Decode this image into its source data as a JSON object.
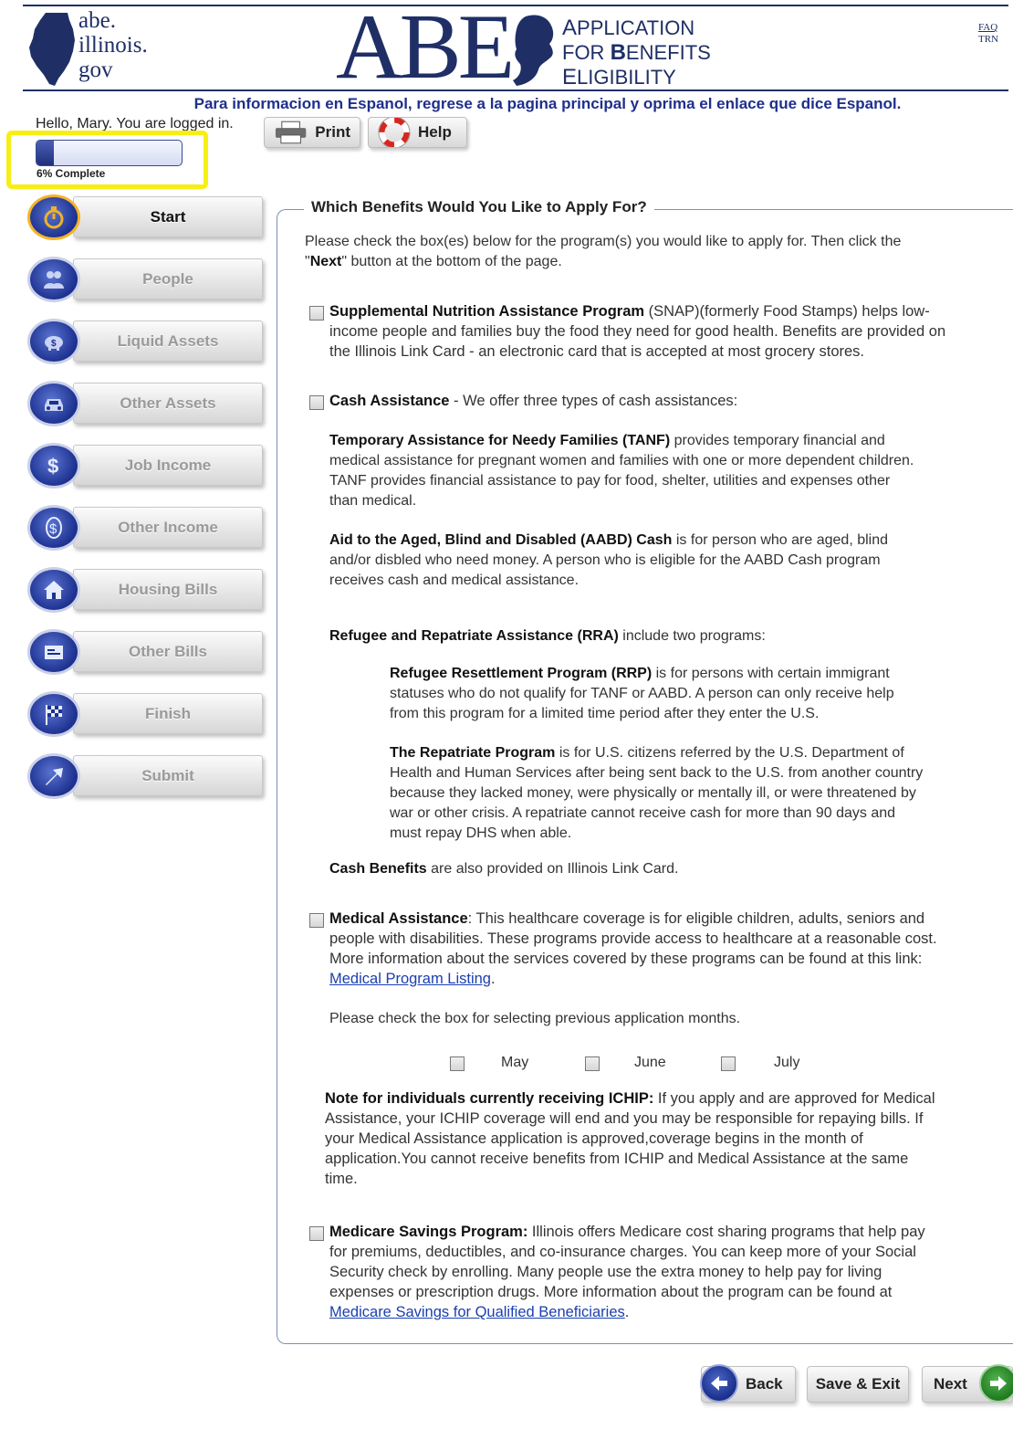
{
  "header": {
    "logo_lines": [
      "abe.",
      "illinois.",
      "gov"
    ],
    "abe_letters": "ABE",
    "app_title_lines": [
      {
        "cap": "A",
        "rest": "PPLICATION"
      },
      {
        "pre": "FOR ",
        "cap": "B",
        "rest": "ENEFITS"
      },
      {
        "cap": "E",
        "rest": "LIGIBILITY"
      }
    ],
    "faq_label": "FAQ",
    "trn_label": "TRN",
    "espanol_notice": "Para informacion en Espanol, regrese a la pagina principal y oprima el enlace que dice Espanol.",
    "greeting": "Hello, Mary. You are logged in."
  },
  "toolbar": {
    "print_label": "Print",
    "help_label": "Help"
  },
  "progress": {
    "percent": 6,
    "label": "6% Complete"
  },
  "sidebar": {
    "items": [
      {
        "label": "Start",
        "icon": "stopwatch-icon",
        "active": true
      },
      {
        "label": "People",
        "icon": "people-icon",
        "active": false
      },
      {
        "label": "Liquid Assets",
        "icon": "piggy-bank-icon",
        "active": false
      },
      {
        "label": "Other Assets",
        "icon": "car-icon",
        "active": false
      },
      {
        "label": "Job Income",
        "icon": "dollar-icon",
        "active": false
      },
      {
        "label": "Other Income",
        "icon": "coin-icon",
        "active": false
      },
      {
        "label": "Housing Bills",
        "icon": "house-icon",
        "active": false
      },
      {
        "label": "Other Bills",
        "icon": "bill-icon",
        "active": false
      },
      {
        "label": "Finish",
        "icon": "checkered-flag-icon",
        "active": false
      },
      {
        "label": "Submit",
        "icon": "arrow-icon",
        "active": false
      }
    ]
  },
  "main": {
    "title": "Which Benefits Would You Like to Apply For?",
    "intro_1": "Please check the box(es) below for the program(s) you would like to apply for. Then click the",
    "intro_2_pre": "\"",
    "intro_2_bold": "Next",
    "intro_2_post": "\" button at the bottom of the page.",
    "snap": {
      "bold": "Supplemental Nutrition Assistance Program",
      "line1": " (SNAP)(formerly Food Stamps) helps low-",
      "line2": "income people and families buy the food they need for good health. Benefits are provided on",
      "line3": "the Illinois Link Card - an electronic card that is accepted at most grocery stores."
    },
    "cash": {
      "bold": "Cash Assistance",
      "rest": " - We offer three types of cash assistances:",
      "tanf_bold": "Temporary Assistance for Needy Families (TANF)",
      "tanf_1": " provides temporary financial and",
      "tanf_2": "medical assistance for pregnant women and families with one or more dependent children.",
      "tanf_3": "TANF provides financial assistance to pay for food, shelter, utilities and expenses other",
      "tanf_4": "than medical.",
      "aabd_bold": "Aid to the Aged, Blind and Disabled (AABD) Cash",
      "aabd_1": " is for person who are aged, blind",
      "aabd_2": "and/or disbled who need money. A person who is eligible for the AABD Cash program",
      "aabd_3": "receives cash and medical assistance.",
      "rra_bold": "Refugee and Repatriate Assistance (RRA)",
      "rra_rest": " include two programs:",
      "rrp_bold": "Refugee Resettlement Program (RRP)",
      "rrp_1": " is for persons with certain immigrant",
      "rrp_2": "statuses who do not qualify for TANF or AABD. A person can only receive help",
      "rrp_3": "from this program for a limited time period after they enter the U.S.",
      "rep_bold": "The Repatriate Program",
      "rep_1": " is for U.S. citizens referred by the U.S. Department of",
      "rep_2": "Health and Human Services after being sent back to the U.S. from another country",
      "rep_3": "because they lacked money, were physically or mentally ill, or were threatened by",
      "rep_4": "war or other crisis. A repatriate cannot receive cash for more than 90 days and",
      "rep_5": "must repay DHS when able.",
      "benefits_bold": "Cash Benefits",
      "benefits_rest": " are also provided on Illinois Link Card."
    },
    "medical": {
      "bold": "Medical Assistance",
      "line1": ": This healthcare coverage is for eligible children, adults, seniors and",
      "line2": "people with disabilities. These programs provide access to healthcare at a reasonable cost.",
      "line3": "More information about the services covered by these programs can be found at this link:",
      "link": "Medical Program Listing",
      "link_after": ".",
      "months_prompt": "Please check the box for selecting previous application months.",
      "months": [
        "May",
        "June",
        "July"
      ],
      "ichip_bold": "Note for individuals currently receiving ICHIP:",
      "ichip_1": " If you apply and are approved for Medical",
      "ichip_2": "Assistance, your ICHIP coverage will end and you may be responsible for repaying bills. If",
      "ichip_3": "your Medical Assistance application is approved,coverage begins in the month of",
      "ichip_4": "application.You cannot receive benefits from ICHIP and Medical Assistance at the same",
      "ichip_5": "time."
    },
    "medicare": {
      "bold": "Medicare Savings Program:",
      "line1": " Illinois offers Medicare cost sharing programs that help pay",
      "line2": "for premiums, deductibles, and co-insurance charges. You can keep more of your Social",
      "line3": "Security check by enrolling. Many people use the extra money to help pay for living",
      "line4": "expenses or prescription drugs. More information about the program can be found at",
      "link": "Medicare Savings for Qualified Beneficiaries",
      "link_after": "."
    }
  },
  "footer": {
    "back_label": "Back",
    "save_label": "Save & Exit",
    "next_label": "Next"
  },
  "colors": {
    "brand_navy": "#1f2f66",
    "highlight_yellow": "#f7ef13",
    "link_blue": "#1a3fb0",
    "next_green": "#2e8f2c"
  }
}
